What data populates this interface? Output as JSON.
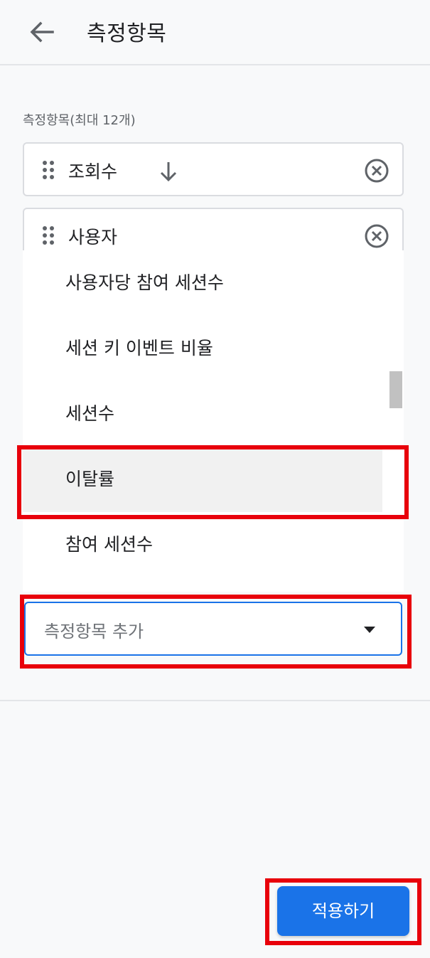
{
  "header": {
    "title": "측정항목",
    "back_icon": "arrow-back-icon"
  },
  "section": {
    "label": "측정항목(최대 12개)"
  },
  "selected_metrics": [
    {
      "label": "조회수",
      "sort_icon": "arrow-down-icon"
    },
    {
      "label": "사용자"
    }
  ],
  "menu": {
    "items": [
      {
        "label": "사용자당 참여 세션수"
      },
      {
        "label": "세션 키 이벤트 비율"
      },
      {
        "label": "세션수"
      },
      {
        "label": "이탈률",
        "selected": true
      },
      {
        "label": "참여 세션수"
      }
    ]
  },
  "select": {
    "placeholder": "측정항목 추가"
  },
  "footer": {
    "apply_label": "적용하기"
  },
  "colors": {
    "accent": "#1a73e8",
    "highlight": "#e8000b",
    "background": "#f8f9fa"
  }
}
